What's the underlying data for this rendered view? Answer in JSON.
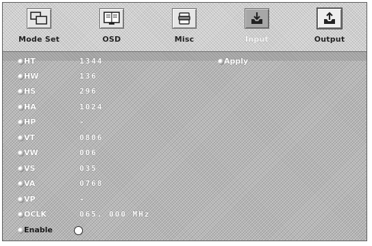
{
  "tabs": [
    {
      "label": "Mode Set",
      "icon": "mode-set-icon",
      "state": "normal"
    },
    {
      "label": "OSD",
      "icon": "osd-icon",
      "state": "normal"
    },
    {
      "label": "Misc",
      "icon": "misc-icon",
      "state": "normal"
    },
    {
      "label": "Input",
      "icon": "input-icon",
      "state": "selected"
    },
    {
      "label": "Output",
      "icon": "output-icon",
      "state": "active"
    }
  ],
  "apply_label": "Apply",
  "rows": [
    {
      "label": "HT",
      "value": "1344"
    },
    {
      "label": "HW",
      "value": "136"
    },
    {
      "label": "HS",
      "value": "296"
    },
    {
      "label": "HA",
      "value": "1024"
    },
    {
      "label": "HP",
      "value": "-"
    },
    {
      "label": "VT",
      "value": "0806"
    },
    {
      "label": "VW",
      "value": "006"
    },
    {
      "label": "VS",
      "value": "035"
    },
    {
      "label": "VA",
      "value": "0768"
    },
    {
      "label": "VP",
      "value": "-"
    },
    {
      "label": "OCLK",
      "value": "065. 000 MHz"
    }
  ],
  "enable": {
    "label": "Enable",
    "checked": false
  },
  "colors": {
    "text_light": "#ffffff",
    "text_dark": "#1a1a1a",
    "panel": "#b9b9b9"
  }
}
